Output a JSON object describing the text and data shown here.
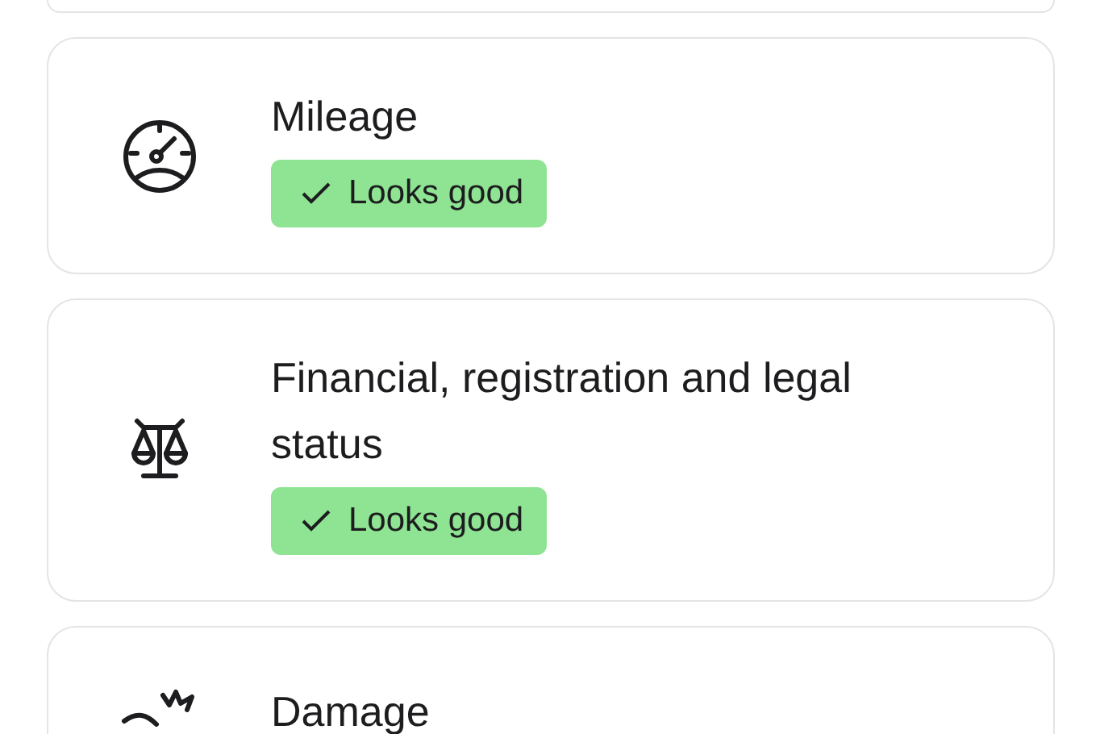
{
  "checks": [
    {
      "kind": "gauge",
      "title": "Mileage",
      "status": {
        "kind": "good",
        "label": "Looks good"
      }
    },
    {
      "kind": "scale",
      "title": "Financial, registration and legal status",
      "status": {
        "kind": "good",
        "label": "Looks good"
      }
    },
    {
      "kind": "burst",
      "title": "Damage"
    }
  ]
}
